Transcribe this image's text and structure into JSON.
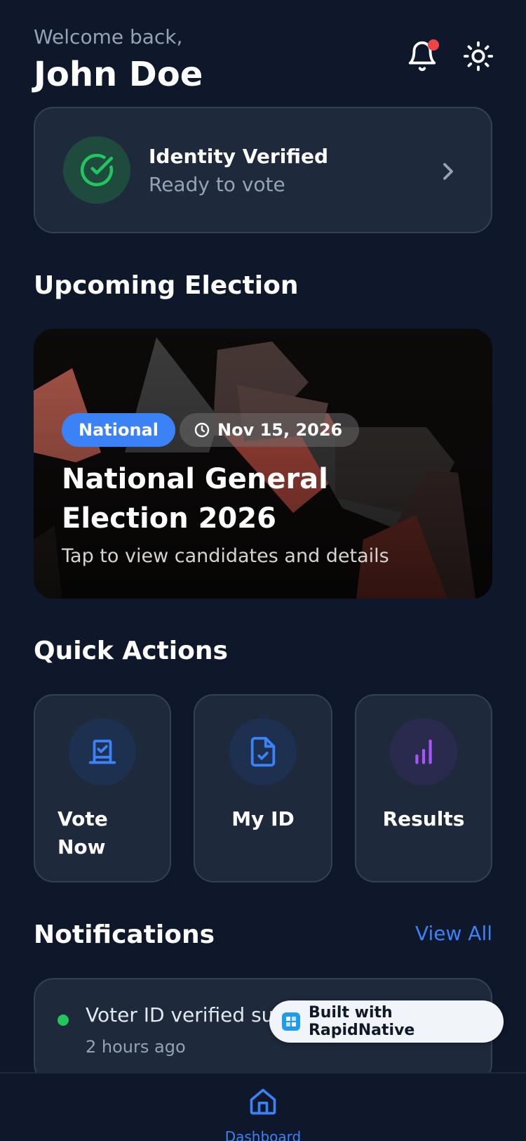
{
  "header": {
    "welcome": "Welcome back,",
    "user_name": "John Doe"
  },
  "identity": {
    "title": "Identity Verified",
    "subtitle": "Ready to vote"
  },
  "sections": {
    "upcoming": "Upcoming Election",
    "quick_actions": "Quick Actions",
    "notifications": "Notifications",
    "view_all": "View All"
  },
  "election": {
    "badge": "National",
    "date": "Nov 15, 2026",
    "title": "National General Election 2026",
    "subtitle": "Tap to view candidates and details"
  },
  "quick_actions": [
    {
      "label": "Vote Now",
      "icon": "ballot-icon"
    },
    {
      "label": "My ID",
      "icon": "id-document-icon"
    },
    {
      "label": "Results",
      "icon": "bar-chart-icon"
    }
  ],
  "notifications": [
    {
      "text": "Voter ID verified successfully",
      "time": "2 hours ago"
    }
  ],
  "badge": {
    "text": "Built with RapidNative"
  },
  "nav": {
    "dashboard": "Dashboard"
  },
  "colors": {
    "background": "#0f172a",
    "card": "#1e293b",
    "accent": "#3b82f6",
    "success": "#22c55e",
    "alert": "#ef4444",
    "purple": "#a855f7"
  }
}
